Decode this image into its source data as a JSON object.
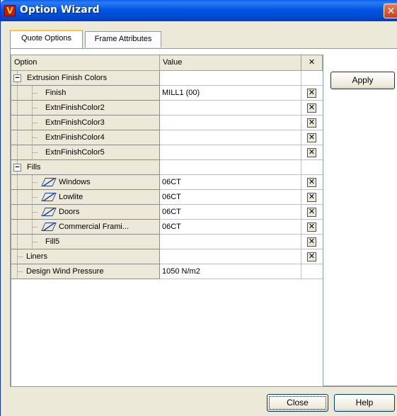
{
  "window": {
    "title": "Option Wizard",
    "app_icon_text": "V"
  },
  "tabs": [
    {
      "label": "Quote Options",
      "active": true
    },
    {
      "label": "Frame Attributes",
      "active": false
    }
  ],
  "grid": {
    "headers": {
      "option": "Option",
      "value": "Value",
      "clear": "✕"
    },
    "rows": [
      {
        "label": "Extrusion Finish Colors",
        "value": "",
        "level": 0,
        "expander": "−",
        "clear": false
      },
      {
        "label": "Finish",
        "value": "MILL1 (00)",
        "level": 1,
        "clear": true
      },
      {
        "label": "ExtnFinishColor2",
        "value": "",
        "level": 1,
        "clear": true
      },
      {
        "label": "ExtnFinishColor3",
        "value": "",
        "level": 1,
        "clear": true
      },
      {
        "label": "ExtnFinishColor4",
        "value": "",
        "level": 1,
        "clear": true
      },
      {
        "label": "ExtnFinishColor5",
        "value": "",
        "level": 1,
        "clear": true
      },
      {
        "label": "Fills",
        "value": "",
        "level": 0,
        "expander": "−",
        "clear": false
      },
      {
        "label": "Windows",
        "value": "06CT",
        "level": 1,
        "icon": "fill-icon",
        "clear": true
      },
      {
        "label": "Lowlite",
        "value": "06CT",
        "level": 1,
        "icon": "fill-icon",
        "clear": true
      },
      {
        "label": "Doors",
        "value": "06CT",
        "level": 1,
        "icon": "fill-icon",
        "clear": true
      },
      {
        "label": "Commercial Frami...",
        "value": "06CT",
        "level": 1,
        "icon": "fill-icon",
        "clear": true
      },
      {
        "label": "Fill5",
        "value": "",
        "level": 1,
        "clear": true
      },
      {
        "label": "Liners",
        "value": "",
        "level": 0,
        "clear": true
      },
      {
        "label": "Design Wind Pressure",
        "value": "1050 N/m2",
        "level": 0,
        "clear": false
      }
    ],
    "clear_glyph": "✕"
  },
  "buttons": {
    "apply": "Apply",
    "close": "Close",
    "help": "Help",
    "window_close": "✕"
  }
}
